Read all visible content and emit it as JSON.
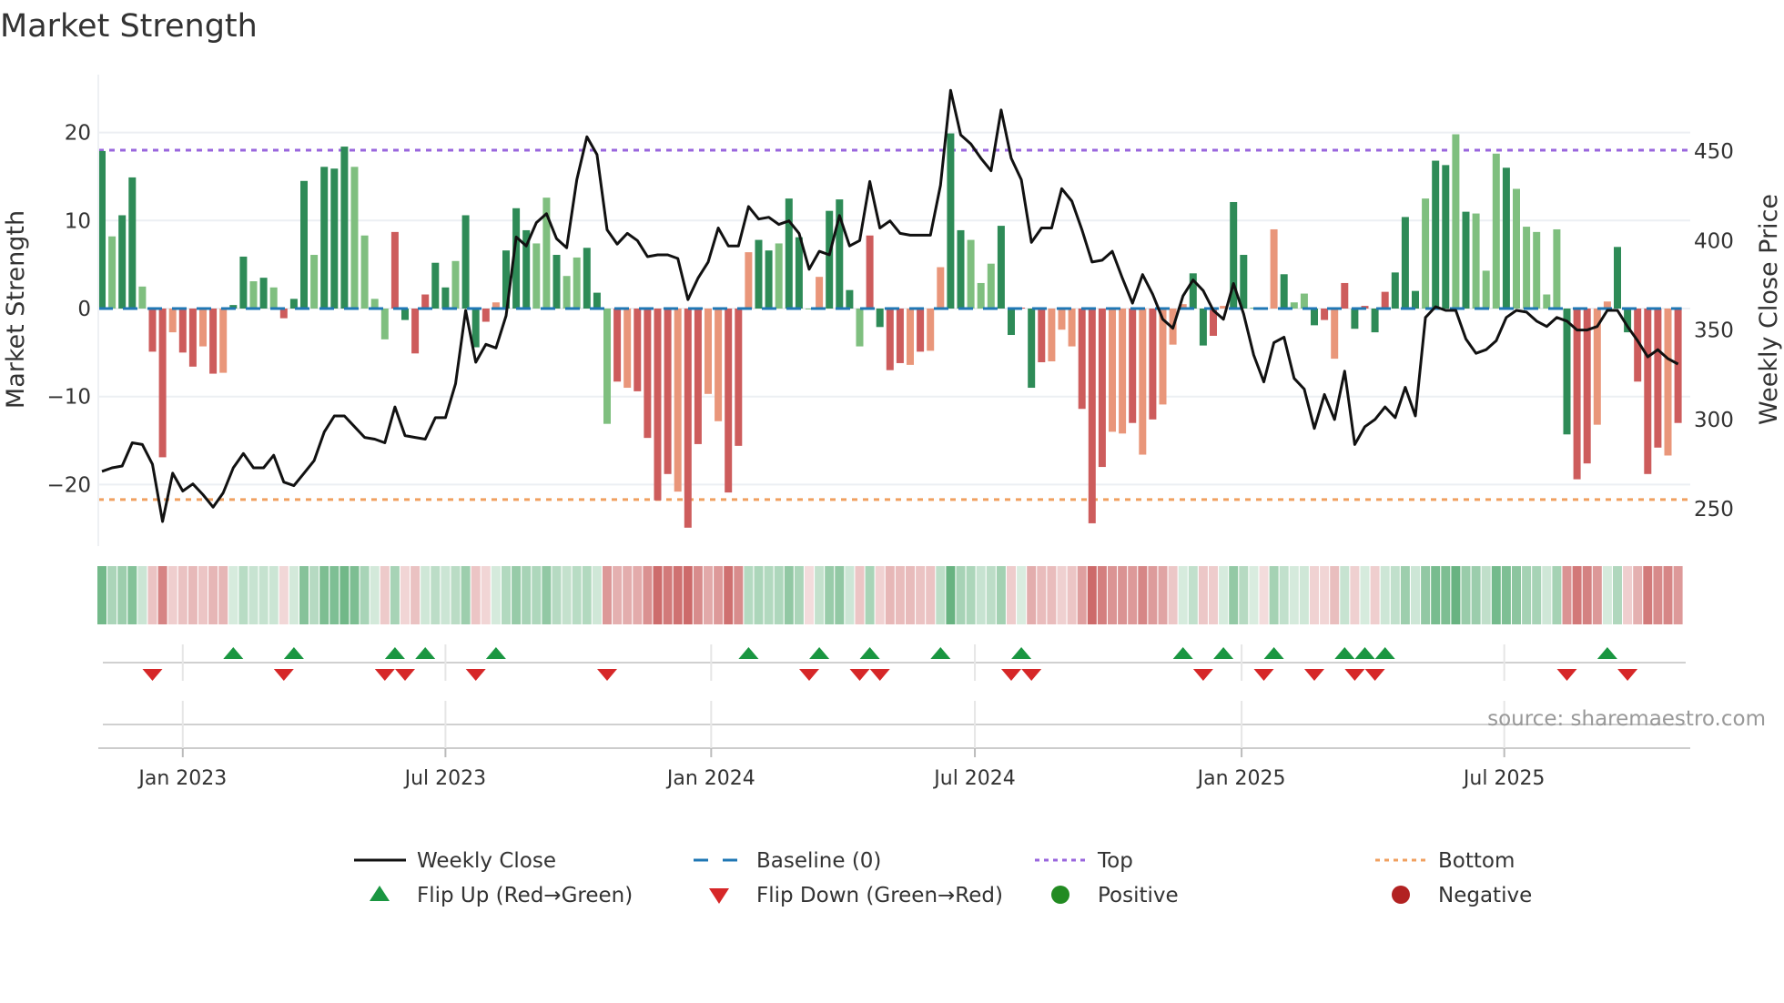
{
  "chart_data": {
    "type": "bar",
    "title": "Market Strength",
    "ylabel": "Market Strength",
    "y2label": "Weekly Close Price",
    "ylim": [
      -27,
      27
    ],
    "y2lim": [
      227,
      497
    ],
    "y_ticks": [
      "20",
      "10",
      "0",
      "−10",
      "−20"
    ],
    "y_tick_values": [
      20,
      10,
      0,
      -10,
      -20
    ],
    "y2_ticks": [
      "450",
      "400",
      "350",
      "300",
      "250"
    ],
    "y2_tick_values": [
      450,
      400,
      350,
      300,
      250
    ],
    "x_ticks": [
      {
        "label": "Jan 2023",
        "week_index": 8.0
      },
      {
        "label": "Jul 2023",
        "week_index": 34.0
      },
      {
        "label": "Jan 2024",
        "week_index": 60.3
      },
      {
        "label": "Jul 2024",
        "week_index": 86.4
      },
      {
        "label": "Jan 2025",
        "week_index": 112.8
      },
      {
        "label": "Jul 2025",
        "week_index": 138.8
      }
    ],
    "top_level": 18.0,
    "bottom_level": -21.7,
    "baseline": 0,
    "strength": [
      17.9,
      8.2,
      10.6,
      14.9,
      2.5,
      -4.9,
      -16.9,
      -2.7,
      -5.0,
      -6.6,
      -4.3,
      -7.4,
      -7.3,
      0.4,
      5.9,
      3.1,
      3.5,
      2.4,
      -1.1,
      1.1,
      14.5,
      6.1,
      16.1,
      15.9,
      18.4,
      16.1,
      8.3,
      1.1,
      -3.5,
      8.7,
      -1.3,
      -5.1,
      1.6,
      5.2,
      2.4,
      5.4,
      10.6,
      -4.4,
      -1.5,
      0.7,
      6.6,
      11.4,
      8.9,
      7.4,
      12.6,
      6.1,
      3.7,
      5.8,
      6.9,
      1.8,
      -13.1,
      -8.3,
      -9.0,
      -9.4,
      -14.7,
      -21.8,
      -18.8,
      -20.8,
      -24.9,
      -15.4,
      -9.7,
      -12.8,
      -20.9,
      -15.6,
      6.4,
      7.8,
      6.6,
      7.4,
      12.5,
      8.1,
      -0.1,
      3.6,
      11.1,
      12.4,
      2.1,
      -4.3,
      8.3,
      -2.1,
      -7.0,
      -6.2,
      -6.4,
      -4.9,
      -4.8,
      4.7,
      19.9,
      8.9,
      7.8,
      2.9,
      5.1,
      9.4,
      -3.0,
      0.1,
      -9.0,
      -6.1,
      -6.0,
      -2.4,
      -4.3,
      -11.4,
      -24.4,
      -18.0,
      -14.0,
      -14.2,
      -13.0,
      -16.6,
      -12.6,
      -10.9,
      -4.1,
      0.5,
      4.0,
      -4.2,
      -3.1,
      0.3,
      12.1,
      6.1,
      0.1,
      -0.1,
      9.0,
      3.9,
      0.7,
      1.7,
      -1.9,
      -1.3,
      -5.7,
      2.9,
      -2.3,
      0.3,
      -2.7,
      1.9,
      4.1,
      10.4,
      2.0,
      12.5,
      16.8,
      16.3,
      19.8,
      11.0,
      10.8,
      4.3,
      17.6,
      16.0,
      13.6,
      9.3,
      8.7,
      1.6,
      9.0,
      -14.3,
      -19.4,
      -17.6,
      -13.2,
      0.8,
      7.0,
      -2.7,
      -8.3,
      -18.8,
      -15.8,
      -16.7,
      -13.0
    ],
    "tone": "GgGGgRRrRRrRrGGgGgRGGgGGGggggRGRRGGgGGRrGGGggGggGGgRrRRRRrRRrrRRrGGgGGgrGGGgRGRRrRrrGGgggGGRGRrrrRRRrrRrRrrrGGRrGGggrGggGRrRGRGRGGGgGGgGgggGgggggGRRrrGGRRRrRr",
    "weekly_close": [
      271,
      273,
      274,
      287,
      286,
      275,
      243,
      270,
      260,
      264,
      258,
      251,
      259,
      273,
      281,
      273,
      273,
      280,
      265,
      263,
      270,
      277,
      293,
      302,
      302,
      296,
      290,
      289,
      287,
      307,
      291,
      290,
      289,
      301,
      301,
      320,
      361,
      332,
      342,
      340,
      358,
      402,
      397,
      410,
      415,
      401,
      396,
      434,
      458,
      448,
      406,
      398,
      404,
      400,
      391,
      392,
      392,
      390,
      367,
      379,
      388,
      407,
      397,
      397,
      419,
      412,
      413,
      409,
      411,
      404,
      384,
      394,
      392,
      414,
      397,
      400,
      433,
      407,
      411,
      404,
      403,
      403,
      403,
      431,
      484,
      459,
      454,
      446,
      439,
      473,
      446,
      434,
      399,
      407,
      407,
      429,
      422,
      406,
      388,
      389,
      394,
      379,
      365,
      381,
      370,
      356,
      351,
      369,
      378,
      372,
      361,
      356,
      376,
      359,
      336,
      321,
      343,
      346,
      323,
      317,
      295,
      314,
      300,
      327,
      286,
      296,
      300,
      307,
      301,
      318,
      302,
      357,
      363,
      361,
      361,
      345,
      337,
      339,
      344,
      357,
      361,
      360,
      355,
      352,
      357,
      355,
      350,
      350,
      352,
      361,
      361,
      352,
      344,
      335,
      339,
      334,
      331
    ],
    "flip_up_weeks": [
      13,
      19,
      29,
      32,
      39,
      64,
      71,
      76,
      83,
      91,
      107,
      111,
      116,
      123,
      125,
      127,
      149
    ],
    "flip_down_weeks": [
      5,
      18,
      28,
      30,
      37,
      50,
      70,
      75,
      77,
      90,
      92,
      109,
      115,
      120,
      124,
      126,
      145,
      151
    ],
    "legend_placement": "bottom",
    "legend": [
      {
        "label": "Weekly Close",
        "kind": "line"
      },
      {
        "label": "Baseline (0)",
        "kind": "dash"
      },
      {
        "label": "Top",
        "kind": "dot"
      },
      {
        "label": "Bottom",
        "kind": "dot"
      },
      {
        "label": "Flip Up (Red→Green)",
        "kind": "up"
      },
      {
        "label": "Flip Down (Green→Red)",
        "kind": "down"
      },
      {
        "label": "Positive",
        "kind": "circle"
      },
      {
        "label": "Negative",
        "kind": "circle"
      }
    ],
    "source": "source: sharemaestro.com"
  },
  "colors": {
    "dark_green": "#2e8b57",
    "light_green": "#7fbf7f",
    "dark_red": "#cd5c5c",
    "light_red": "#e9967a",
    "line": "#111111",
    "baseline": "#1f77b4",
    "top": "#9966dd",
    "bottom": "#f0a060",
    "flip_up": "#1a9641",
    "flip_down": "#d62728",
    "positive": "#228b22",
    "negative": "#b22222",
    "grid": "#eceff3"
  }
}
